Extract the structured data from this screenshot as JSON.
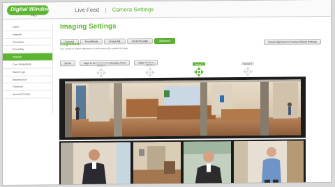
{
  "header": {
    "logo_text": "Digital Window",
    "logo_sub": "PRO",
    "nav_live": "Live Feed",
    "nav_separator": "|",
    "nav_settings": "Camera Settings"
  },
  "sidebar": {
    "items": [
      {
        "label": "Users",
        "active": false
      },
      {
        "label": "Network",
        "active": false
      },
      {
        "label": "Time/Date",
        "active": false
      },
      {
        "label": "Recording",
        "active": false
      },
      {
        "label": "Imaging",
        "active": true
      },
      {
        "label": "Cam Mode/Bnds",
        "active": false
      },
      {
        "label": "Alarm/Logs",
        "active": false
      },
      {
        "label": "Maintenance",
        "active": false
      },
      {
        "label": "Firmware",
        "active": false
      },
      {
        "label": "Version/Contact",
        "active": false
      }
    ]
  },
  "main": {
    "title": "Imaging Settings",
    "tabs": [
      {
        "label": "General",
        "active": false
      },
      {
        "label": "Fixed/Mods",
        "active": false
      },
      {
        "label": "Image Adj.",
        "active": false
      },
      {
        "label": "Flicker/Quality",
        "active": false
      },
      {
        "label": "Alignment",
        "active": true
      }
    ],
    "section_title": "Alignment",
    "section_desc": "Use arrows to adjust alignment of each sensor for seamless image.",
    "reset_button": "Reset Alignment to Factory Default Settings",
    "actions": [
      "Set All",
      "Align to Center Monitor Mounting Point",
      "Apply Settings"
    ],
    "sensor_tabs": [
      {
        "label": "Sensor 1",
        "active": false
      },
      {
        "label": "Sensor 2",
        "active": false
      },
      {
        "label": "Sensor 3",
        "active": true
      },
      {
        "label": "Sensor 4",
        "active": false
      }
    ]
  },
  "colors": {
    "brand_green": "#5cb531",
    "panel_bg": "#ffffff",
    "image_frame": "#1c1c1c"
  },
  "icons": {
    "move": "move-arrows-icon",
    "logo": "digital-window-logo"
  }
}
